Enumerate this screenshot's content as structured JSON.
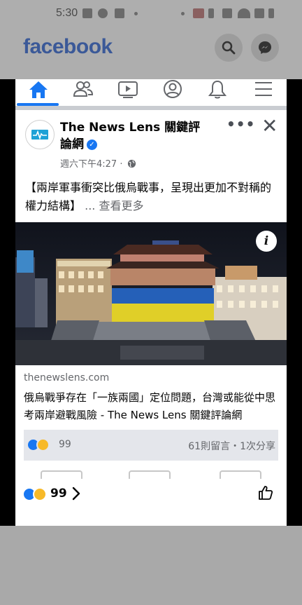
{
  "status_bar": {
    "time": "5:30"
  },
  "app": {
    "logo": "facebook",
    "brand_color": "#3b5998",
    "accent_color": "#1877f2",
    "header_buttons": [
      "search-icon",
      "messenger-icon"
    ],
    "nav_tabs": [
      {
        "name": "home",
        "icon": "home-icon",
        "active": true
      },
      {
        "name": "friends",
        "icon": "friends-icon",
        "active": false
      },
      {
        "name": "watch",
        "icon": "video-icon",
        "active": false
      },
      {
        "name": "profile",
        "icon": "profile-icon",
        "active": false
      },
      {
        "name": "notifications",
        "icon": "bell-icon",
        "active": false
      },
      {
        "name": "menu",
        "icon": "hamburger-icon",
        "active": false
      }
    ]
  },
  "post": {
    "page_name": "The News Lens 關鍵評論網",
    "verified": true,
    "timestamp": "週六下午4:27 ·",
    "privacy_icon": "globe-icon",
    "more_label": "•••",
    "close_label": "✕",
    "text": "【兩岸軍事衝突比俄烏戰事，呈現出更加不對稱的權力結構】",
    "see_more": "... 查看更多",
    "link": {
      "domain": "thenewslens.com",
      "title": "俄烏戰爭存在「一族兩國」定位問題，台灣或能從中思考兩岸避戰風險 - The News Lens 關鍵評論網"
    },
    "reactions": {
      "icons": [
        "like-icon",
        "haha-icon"
      ],
      "count": "99",
      "comments_shares": "61則留言・1次分享"
    }
  },
  "viewer_bar": {
    "count": "99"
  }
}
